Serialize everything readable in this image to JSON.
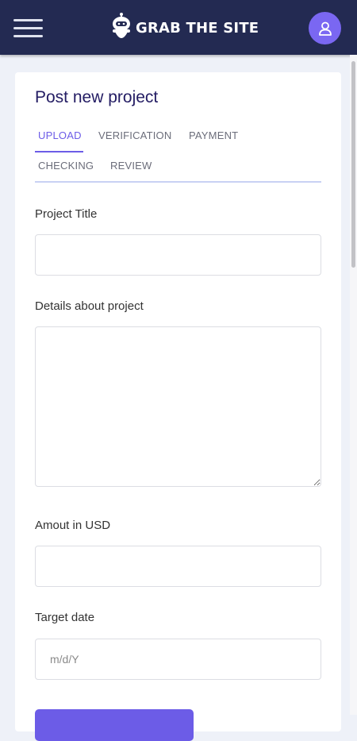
{
  "header": {
    "brand_name": "GRAB THE SITE",
    "menu_icon": "hamburger-icon",
    "logo_icon": "robot-logo-icon",
    "avatar_icon": "user-icon",
    "background_color": "#232a52",
    "avatar_color": "#7a67f2"
  },
  "form": {
    "title": "Post new project",
    "tabs": [
      {
        "label": "UPLOAD",
        "active": true
      },
      {
        "label": "VERIFICATION",
        "active": false
      },
      {
        "label": "PAYMENT",
        "active": false
      },
      {
        "label": "CHECKING",
        "active": false
      },
      {
        "label": "REVIEW",
        "active": false
      }
    ],
    "fields": {
      "project_title": {
        "label": "Project Title",
        "value": "",
        "placeholder": ""
      },
      "details": {
        "label": "Details about project",
        "value": "",
        "placeholder": ""
      },
      "amount": {
        "label": "Amout in USD",
        "value": "",
        "placeholder": ""
      },
      "target_date": {
        "label": "Target date",
        "value": "",
        "placeholder": "m/d/Y"
      }
    },
    "accent_color": "#6c5ce7"
  }
}
